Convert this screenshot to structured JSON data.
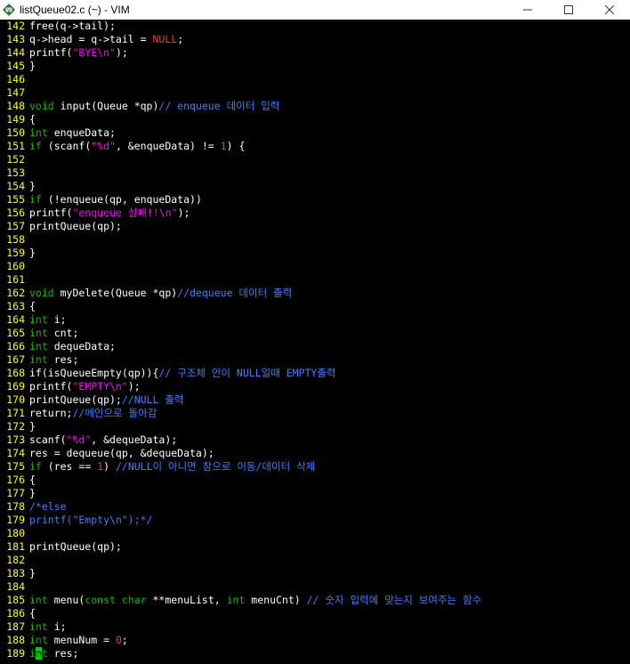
{
  "window": {
    "title": "listQueue02.c (~) - VIM",
    "icon": "vim-icon"
  },
  "colors": {
    "normal": "#ffffff",
    "type": "#00c000",
    "string": "#ff00ff",
    "comment": "#3f7fff",
    "constant": "#ff3030",
    "line_number": "#ffff00",
    "background": "#000000",
    "cursor": "#00d000"
  },
  "editor": {
    "lines": [
      {
        "num": "142",
        "seg": [
          [
            "n",
            "free(q->tail);"
          ]
        ]
      },
      {
        "num": "143",
        "seg": [
          [
            "n",
            "q->head = q->tail = "
          ],
          [
            "r",
            "NULL"
          ],
          [
            "n",
            ";"
          ]
        ]
      },
      {
        "num": "144",
        "seg": [
          [
            "n",
            "printf("
          ],
          [
            "s",
            "\"BYE\\n\""
          ],
          [
            "n",
            ");"
          ]
        ]
      },
      {
        "num": "145",
        "seg": [
          [
            "n",
            "}"
          ]
        ]
      },
      {
        "num": "146",
        "seg": []
      },
      {
        "num": "147",
        "seg": []
      },
      {
        "num": "148",
        "seg": [
          [
            "t",
            "void"
          ],
          [
            "n",
            " input(Queue *qp)"
          ],
          [
            "c",
            "// enqueue 데이터 입력"
          ]
        ]
      },
      {
        "num": "149",
        "seg": [
          [
            "n",
            "{"
          ]
        ]
      },
      {
        "num": "150",
        "seg": [
          [
            "t",
            "int"
          ],
          [
            "n",
            " enqueData;"
          ]
        ]
      },
      {
        "num": "151",
        "seg": [
          [
            "t",
            "if"
          ],
          [
            "n",
            " (scanf("
          ],
          [
            "s",
            "\"%d\""
          ],
          [
            "n",
            ", &enqueData) != "
          ],
          [
            "r",
            "1"
          ],
          [
            "n",
            ") {"
          ]
        ]
      },
      {
        "num": "152",
        "seg": []
      },
      {
        "num": "153",
        "seg": []
      },
      {
        "num": "154",
        "seg": [
          [
            "n",
            "}"
          ]
        ]
      },
      {
        "num": "155",
        "seg": [
          [
            "t",
            "if"
          ],
          [
            "n",
            " (!enqueue(qp, enqueData))"
          ]
        ]
      },
      {
        "num": "156",
        "seg": [
          [
            "n",
            "printf("
          ],
          [
            "s",
            "\"enqueue 실패!!\\n\""
          ],
          [
            "n",
            ");"
          ]
        ]
      },
      {
        "num": "157",
        "seg": [
          [
            "n",
            "printQueue(qp);"
          ]
        ]
      },
      {
        "num": "158",
        "seg": []
      },
      {
        "num": "159",
        "seg": [
          [
            "n",
            "}"
          ]
        ]
      },
      {
        "num": "160",
        "seg": []
      },
      {
        "num": "161",
        "seg": []
      },
      {
        "num": "162",
        "seg": [
          [
            "t",
            "void"
          ],
          [
            "n",
            " myDelete(Queue *qp)"
          ],
          [
            "c",
            "//dequeue 데이터 출력"
          ]
        ]
      },
      {
        "num": "163",
        "seg": [
          [
            "n",
            "{"
          ]
        ]
      },
      {
        "num": "164",
        "seg": [
          [
            "t",
            "int"
          ],
          [
            "n",
            " i;"
          ]
        ]
      },
      {
        "num": "165",
        "seg": [
          [
            "t",
            "int"
          ],
          [
            "n",
            " cnt;"
          ]
        ]
      },
      {
        "num": "166",
        "seg": [
          [
            "t",
            "int"
          ],
          [
            "n",
            " dequeData;"
          ]
        ]
      },
      {
        "num": "167",
        "seg": [
          [
            "t",
            "int"
          ],
          [
            "n",
            " res;"
          ]
        ]
      },
      {
        "num": "168",
        "seg": [
          [
            "n",
            "if(isQueueEmpty(qp)){"
          ],
          [
            "c",
            "// 구조체 안이 NULL일때 EMPTY출력"
          ]
        ]
      },
      {
        "num": "169",
        "seg": [
          [
            "n",
            "printf("
          ],
          [
            "s",
            "\"EMPTY\\n\""
          ],
          [
            "n",
            ");"
          ]
        ]
      },
      {
        "num": "170",
        "seg": [
          [
            "n",
            "printQueue(qp);"
          ],
          [
            "c",
            "//NULL 출력"
          ]
        ]
      },
      {
        "num": "171",
        "seg": [
          [
            "n",
            "return;"
          ],
          [
            "c",
            "//메인으로 돌아감"
          ]
        ]
      },
      {
        "num": "172",
        "seg": [
          [
            "n",
            "}"
          ]
        ]
      },
      {
        "num": "173",
        "seg": [
          [
            "n",
            "scanf("
          ],
          [
            "s",
            "\"%d\""
          ],
          [
            "n",
            ", &dequeData);"
          ]
        ]
      },
      {
        "num": "174",
        "seg": [
          [
            "n",
            "res = dequeue(qp, &dequeData);"
          ]
        ]
      },
      {
        "num": "175",
        "seg": [
          [
            "t",
            "if"
          ],
          [
            "n",
            " (res == "
          ],
          [
            "r",
            "1"
          ],
          [
            "n",
            ") "
          ],
          [
            "c",
            "//NULL이 아니면 참으로 이동/데이터 삭제"
          ]
        ]
      },
      {
        "num": "176",
        "seg": [
          [
            "n",
            "{"
          ]
        ]
      },
      {
        "num": "177",
        "seg": [
          [
            "n",
            "}"
          ]
        ]
      },
      {
        "num": "178",
        "seg": [
          [
            "c",
            "/*else"
          ]
        ]
      },
      {
        "num": "179",
        "seg": [
          [
            "c",
            "printf(\"Empty\\n\");*/"
          ]
        ]
      },
      {
        "num": "180",
        "seg": []
      },
      {
        "num": "181",
        "seg": [
          [
            "n",
            "printQueue(qp);"
          ]
        ]
      },
      {
        "num": "182",
        "seg": []
      },
      {
        "num": "183",
        "seg": [
          [
            "n",
            "}"
          ]
        ]
      },
      {
        "num": "184",
        "seg": []
      },
      {
        "num": "185",
        "seg": [
          [
            "t",
            "int"
          ],
          [
            "n",
            " menu("
          ],
          [
            "t",
            "const char"
          ],
          [
            "n",
            " **menuList, "
          ],
          [
            "t",
            "int"
          ],
          [
            "n",
            " menuCnt) "
          ],
          [
            "c",
            "// 숫자 입력에 맞는지 보여주는 함수"
          ]
        ]
      },
      {
        "num": "186",
        "seg": [
          [
            "n",
            "{"
          ]
        ]
      },
      {
        "num": "187",
        "seg": [
          [
            "t",
            "int"
          ],
          [
            "n",
            " i;"
          ]
        ]
      },
      {
        "num": "188",
        "seg": [
          [
            "t",
            "int"
          ],
          [
            "n",
            " menuNum = "
          ],
          [
            "r",
            "0"
          ],
          [
            "n",
            ";"
          ]
        ]
      },
      {
        "num": "189",
        "seg": [
          [
            "t",
            "i"
          ],
          [
            "k",
            "n"
          ],
          [
            "t",
            "t"
          ],
          [
            "n",
            " res;"
          ]
        ]
      }
    ]
  }
}
